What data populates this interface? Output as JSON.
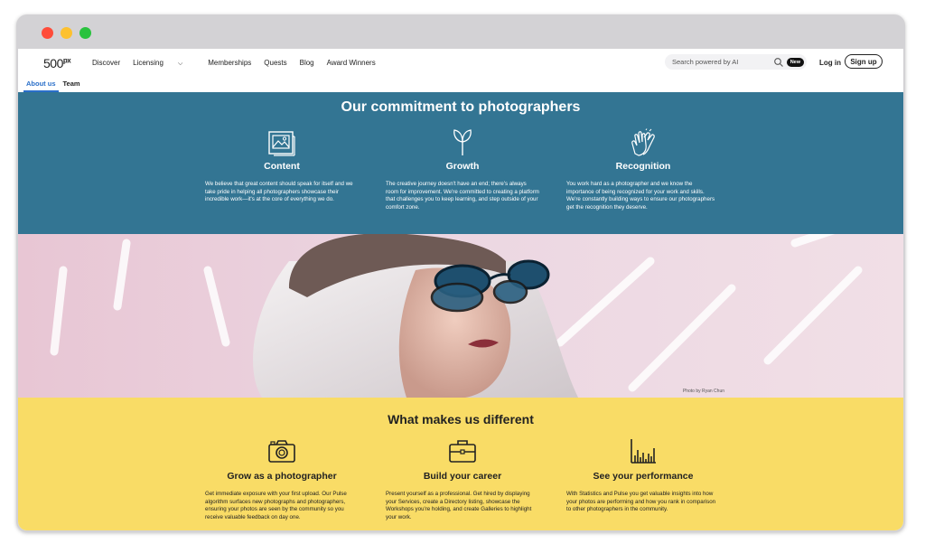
{
  "window": {
    "buttons": [
      {
        "name": "close",
        "color": "#ff4c3a"
      },
      {
        "name": "minimize",
        "color": "#fdc12f"
      },
      {
        "name": "maximize",
        "color": "#29c23e"
      }
    ]
  },
  "nav": {
    "logo_text": "500",
    "logo_sup": "px",
    "links": [
      "Discover",
      "Licensing",
      "Memberships",
      "Quests",
      "Blog",
      "Award Winners"
    ],
    "search_placeholder": "Search powered by AI",
    "new_badge": "New",
    "login_label": "Log in",
    "signup_label": "Sign up"
  },
  "subnav": {
    "tabs": [
      {
        "label": "About us",
        "active": true
      },
      {
        "label": "Team",
        "active": false
      }
    ]
  },
  "commitment": {
    "title": "Our commitment to photographers",
    "background": "#337593",
    "items": [
      {
        "icon": "image-gallery-icon",
        "title": "Content",
        "text": "We believe that great content should speak for itself and we take pride in helping all photographers showcase their incredible work—it's at the core of everything we do."
      },
      {
        "icon": "sprout-icon",
        "title": "Growth",
        "text": "The creative journey doesn't have an end; there's always room for improvement. We're committed to creating a platform that challenges you to keep learning, and step outside of your comfort zone."
      },
      {
        "icon": "clapping-hands-icon",
        "title": "Recognition",
        "text": "You work hard as a photographer and we know the importance of being recognized for your work and skills. We're constantly building ways to ensure our photographers get the recognition they deserve."
      }
    ]
  },
  "photo": {
    "credit": "Photo by Ryan Chun"
  },
  "different": {
    "title": "What makes us different",
    "background": "#f9dc66",
    "items": [
      {
        "icon": "camera-icon",
        "title": "Grow as a photographer",
        "text": "Get immediate exposure with your first upload. Our Pulse algorithm surfaces new photographs and photographers, ensuring your photos are seen by the community so you receive valuable feedback on day one."
      },
      {
        "icon": "briefcase-icon",
        "title": "Build your career",
        "text": "Present yourself as a professional. Get hired by displaying your Services, create a Directory listing, showcase the Workshops you're holding, and create Galleries to highlight your work."
      },
      {
        "icon": "bar-chart-icon",
        "title": "See your performance",
        "text": "With Statistics and Pulse you get valuable insights into how your photos are performing and how you rank in comparison to other photographers in the community."
      }
    ]
  }
}
